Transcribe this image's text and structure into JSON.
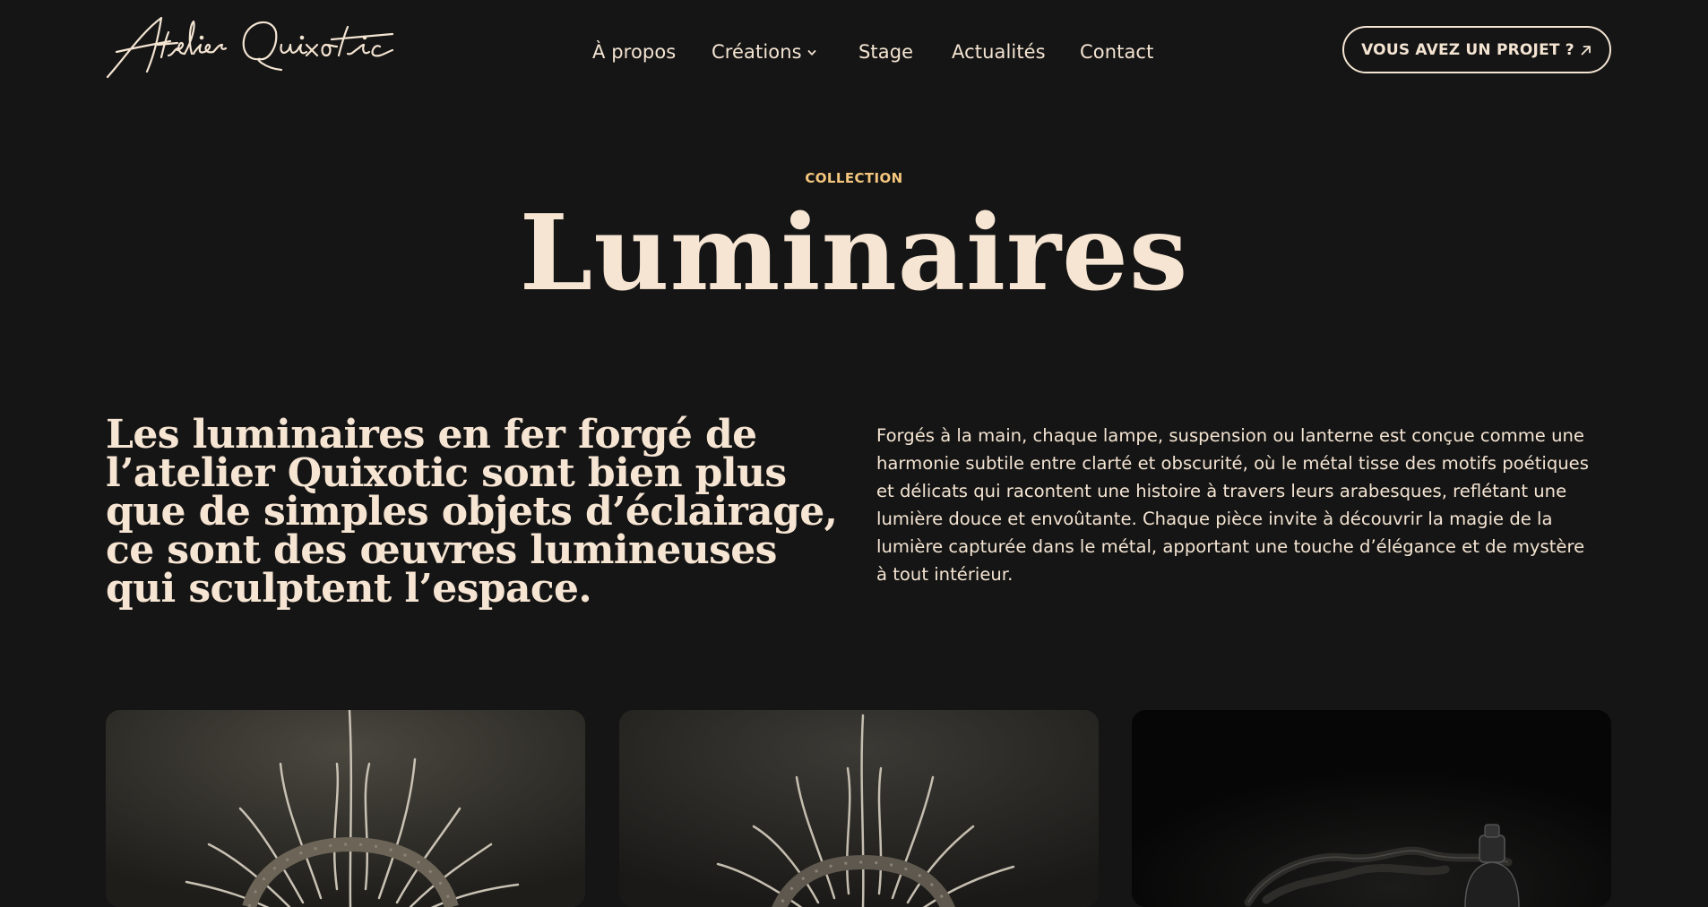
{
  "header": {
    "logo_text": "Atelier Quixotic",
    "nav": [
      {
        "label": "À propos"
      },
      {
        "label": "Créations",
        "has_dropdown": true
      },
      {
        "label": "Stage"
      },
      {
        "label": "Actualités"
      },
      {
        "label": "Contact"
      }
    ],
    "cta_label": "VOUS AVEZ UN PROJET ?"
  },
  "hero": {
    "eyebrow": "COLLECTION",
    "title": "Luminaires"
  },
  "intro": {
    "lead": "Les luminaires en fer forgé de l’atelier Quixotic sont bien plus que de simples objets d’éclairage, ce sont des œuvres lumineuses qui sculptent l’espace.",
    "body": "Forgés à la main, chaque lampe, suspension ou lanterne est conçue comme une harmonie subtile entre clarté et obscurité, où le métal tisse des motifs poétiques et délicats qui racontent une histoire à travers leurs arabesques, reflétant une lumière douce et envoûtante. Chaque pièce invite à découvrir la magie de la lumière capturée dans le métal, apportant une touche d’élégance et de mystère à tout intérieur."
  },
  "colors": {
    "background": "#151515",
    "text": "#f4e4d2",
    "accent": "#f5c77e"
  },
  "icons": {
    "dropdown": "chevron-down-icon",
    "cta": "arrow-up-right-icon"
  }
}
